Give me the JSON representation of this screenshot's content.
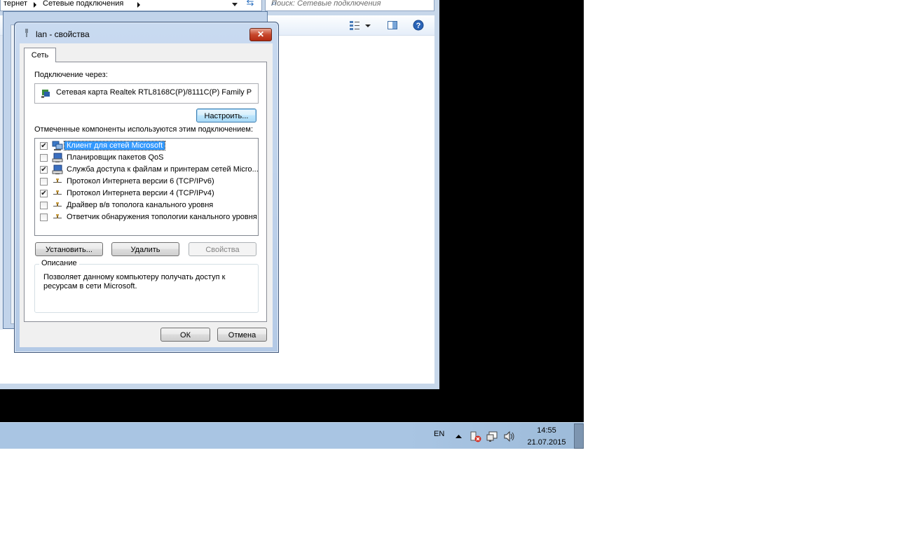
{
  "explorer": {
    "breadcrumb": [
      "тернет",
      "Сетевые подключения"
    ],
    "search_placeholder": "Поиск: Сетевые подключения"
  },
  "dialog": {
    "title": "lan - свойства",
    "close_glyph": "✕",
    "tab_label": "Сеть",
    "connect_using_label": "Подключение через:",
    "adapter_name": "Сетевая карта Realtek RTL8168C(P)/8111C(P) Family P",
    "configure_button": "Настроить...",
    "components_label": "Отмеченные компоненты используются этим подключением:",
    "components": [
      {
        "label": "Клиент для сетей Microsoft",
        "checked": true,
        "selected": true,
        "icon": "network-client-icon"
      },
      {
        "label": "Планировщик пакетов QoS",
        "checked": false,
        "selected": false,
        "icon": "service-icon"
      },
      {
        "label": "Служба доступа к файлам и принтерам сетей Micro...",
        "checked": true,
        "selected": false,
        "icon": "service-icon"
      },
      {
        "label": "Протокол Интернета версии 6 (TCP/IPv6)",
        "checked": false,
        "selected": false,
        "icon": "protocol-icon"
      },
      {
        "label": "Протокол Интернета версии 4 (TCP/IPv4)",
        "checked": true,
        "selected": false,
        "icon": "protocol-icon"
      },
      {
        "label": "Драйвер в/в тополога канального уровня",
        "checked": false,
        "selected": false,
        "icon": "protocol-icon"
      },
      {
        "label": "Ответчик обнаружения топологии канального уровня",
        "checked": false,
        "selected": false,
        "icon": "protocol-icon"
      }
    ],
    "install_button": "Установить...",
    "uninstall_button": "Удалить",
    "properties_button": "Свойства",
    "description_legend": "Описание",
    "description_text": "Позволяет данному компьютеру получать доступ к ресурсам в сети Microsoft.",
    "ok_button": "ОК",
    "cancel_button": "Отмена"
  },
  "taskbar": {
    "language": "EN",
    "time": "14:55",
    "date": "21.07.2015"
  },
  "colors": {
    "selection": "#3399ff",
    "taskbar": "#a9c5e3",
    "close_button": "#c7472c"
  }
}
